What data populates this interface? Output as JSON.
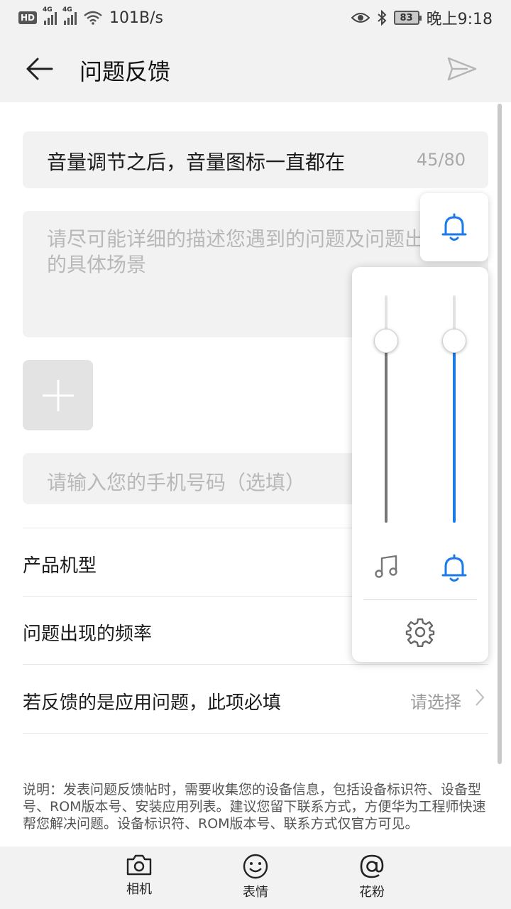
{
  "status_bar": {
    "hd": "HD",
    "net1": "4G",
    "net2": "4G",
    "speed": "101B/s",
    "battery": "83",
    "time": "晚上9:18"
  },
  "header": {
    "title": "问题反馈"
  },
  "form": {
    "title_value": "音量调节之后，音量图标一直都在",
    "title_count": "45/80",
    "description_placeholder": "请尽可能详细的描述您遇到的问题及问题出现的具体场景",
    "phone_placeholder": "请输入您的手机号码（选填）",
    "rows": [
      {
        "label": "产品机型",
        "value": ""
      },
      {
        "label": "问题出现的频率",
        "value": ""
      },
      {
        "label": "若反馈的是应用问题，此项必填",
        "value": "请选择"
      }
    ],
    "note": "说明：发表问题反馈帖时，需要收集您的设备信息，包括设备标识符、设备型号、ROM版本号、安装应用列表。建议您留下联系方式，方便华为工程师快速帮您解决问题。设备标识符、ROM版本号、联系方式仅官方可见。"
  },
  "toolbar": {
    "camera": "相机",
    "emoji": "表情",
    "fans": "花粉"
  },
  "volume_panel": {
    "media_level": 0.8,
    "ring_level": 0.8,
    "media_color": "#777777",
    "ring_color": "#1a7be6",
    "accent": "#1a7be6"
  }
}
